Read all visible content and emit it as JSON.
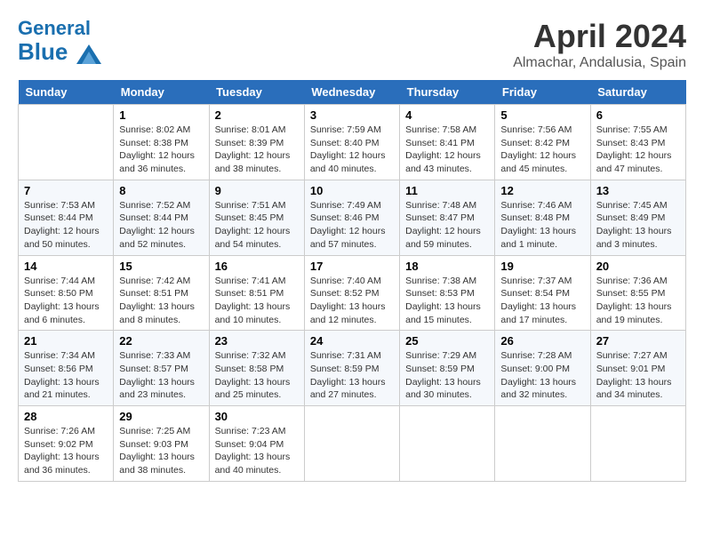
{
  "header": {
    "logo_general": "General",
    "logo_blue": "Blue",
    "month_year": "April 2024",
    "location": "Almachar, Andalusia, Spain"
  },
  "weekdays": [
    "Sunday",
    "Monday",
    "Tuesday",
    "Wednesday",
    "Thursday",
    "Friday",
    "Saturday"
  ],
  "weeks": [
    [
      {
        "day": "",
        "sunrise": "",
        "sunset": "",
        "daylight": ""
      },
      {
        "day": "1",
        "sunrise": "Sunrise: 8:02 AM",
        "sunset": "Sunset: 8:38 PM",
        "daylight": "Daylight: 12 hours and 36 minutes."
      },
      {
        "day": "2",
        "sunrise": "Sunrise: 8:01 AM",
        "sunset": "Sunset: 8:39 PM",
        "daylight": "Daylight: 12 hours and 38 minutes."
      },
      {
        "day": "3",
        "sunrise": "Sunrise: 7:59 AM",
        "sunset": "Sunset: 8:40 PM",
        "daylight": "Daylight: 12 hours and 40 minutes."
      },
      {
        "day": "4",
        "sunrise": "Sunrise: 7:58 AM",
        "sunset": "Sunset: 8:41 PM",
        "daylight": "Daylight: 12 hours and 43 minutes."
      },
      {
        "day": "5",
        "sunrise": "Sunrise: 7:56 AM",
        "sunset": "Sunset: 8:42 PM",
        "daylight": "Daylight: 12 hours and 45 minutes."
      },
      {
        "day": "6",
        "sunrise": "Sunrise: 7:55 AM",
        "sunset": "Sunset: 8:43 PM",
        "daylight": "Daylight: 12 hours and 47 minutes."
      }
    ],
    [
      {
        "day": "7",
        "sunrise": "Sunrise: 7:53 AM",
        "sunset": "Sunset: 8:44 PM",
        "daylight": "Daylight: 12 hours and 50 minutes."
      },
      {
        "day": "8",
        "sunrise": "Sunrise: 7:52 AM",
        "sunset": "Sunset: 8:44 PM",
        "daylight": "Daylight: 12 hours and 52 minutes."
      },
      {
        "day": "9",
        "sunrise": "Sunrise: 7:51 AM",
        "sunset": "Sunset: 8:45 PM",
        "daylight": "Daylight: 12 hours and 54 minutes."
      },
      {
        "day": "10",
        "sunrise": "Sunrise: 7:49 AM",
        "sunset": "Sunset: 8:46 PM",
        "daylight": "Daylight: 12 hours and 57 minutes."
      },
      {
        "day": "11",
        "sunrise": "Sunrise: 7:48 AM",
        "sunset": "Sunset: 8:47 PM",
        "daylight": "Daylight: 12 hours and 59 minutes."
      },
      {
        "day": "12",
        "sunrise": "Sunrise: 7:46 AM",
        "sunset": "Sunset: 8:48 PM",
        "daylight": "Daylight: 13 hours and 1 minute."
      },
      {
        "day": "13",
        "sunrise": "Sunrise: 7:45 AM",
        "sunset": "Sunset: 8:49 PM",
        "daylight": "Daylight: 13 hours and 3 minutes."
      }
    ],
    [
      {
        "day": "14",
        "sunrise": "Sunrise: 7:44 AM",
        "sunset": "Sunset: 8:50 PM",
        "daylight": "Daylight: 13 hours and 6 minutes."
      },
      {
        "day": "15",
        "sunrise": "Sunrise: 7:42 AM",
        "sunset": "Sunset: 8:51 PM",
        "daylight": "Daylight: 13 hours and 8 minutes."
      },
      {
        "day": "16",
        "sunrise": "Sunrise: 7:41 AM",
        "sunset": "Sunset: 8:51 PM",
        "daylight": "Daylight: 13 hours and 10 minutes."
      },
      {
        "day": "17",
        "sunrise": "Sunrise: 7:40 AM",
        "sunset": "Sunset: 8:52 PM",
        "daylight": "Daylight: 13 hours and 12 minutes."
      },
      {
        "day": "18",
        "sunrise": "Sunrise: 7:38 AM",
        "sunset": "Sunset: 8:53 PM",
        "daylight": "Daylight: 13 hours and 15 minutes."
      },
      {
        "day": "19",
        "sunrise": "Sunrise: 7:37 AM",
        "sunset": "Sunset: 8:54 PM",
        "daylight": "Daylight: 13 hours and 17 minutes."
      },
      {
        "day": "20",
        "sunrise": "Sunrise: 7:36 AM",
        "sunset": "Sunset: 8:55 PM",
        "daylight": "Daylight: 13 hours and 19 minutes."
      }
    ],
    [
      {
        "day": "21",
        "sunrise": "Sunrise: 7:34 AM",
        "sunset": "Sunset: 8:56 PM",
        "daylight": "Daylight: 13 hours and 21 minutes."
      },
      {
        "day": "22",
        "sunrise": "Sunrise: 7:33 AM",
        "sunset": "Sunset: 8:57 PM",
        "daylight": "Daylight: 13 hours and 23 minutes."
      },
      {
        "day": "23",
        "sunrise": "Sunrise: 7:32 AM",
        "sunset": "Sunset: 8:58 PM",
        "daylight": "Daylight: 13 hours and 25 minutes."
      },
      {
        "day": "24",
        "sunrise": "Sunrise: 7:31 AM",
        "sunset": "Sunset: 8:59 PM",
        "daylight": "Daylight: 13 hours and 27 minutes."
      },
      {
        "day": "25",
        "sunrise": "Sunrise: 7:29 AM",
        "sunset": "Sunset: 8:59 PM",
        "daylight": "Daylight: 13 hours and 30 minutes."
      },
      {
        "day": "26",
        "sunrise": "Sunrise: 7:28 AM",
        "sunset": "Sunset: 9:00 PM",
        "daylight": "Daylight: 13 hours and 32 minutes."
      },
      {
        "day": "27",
        "sunrise": "Sunrise: 7:27 AM",
        "sunset": "Sunset: 9:01 PM",
        "daylight": "Daylight: 13 hours and 34 minutes."
      }
    ],
    [
      {
        "day": "28",
        "sunrise": "Sunrise: 7:26 AM",
        "sunset": "Sunset: 9:02 PM",
        "daylight": "Daylight: 13 hours and 36 minutes."
      },
      {
        "day": "29",
        "sunrise": "Sunrise: 7:25 AM",
        "sunset": "Sunset: 9:03 PM",
        "daylight": "Daylight: 13 hours and 38 minutes."
      },
      {
        "day": "30",
        "sunrise": "Sunrise: 7:23 AM",
        "sunset": "Sunset: 9:04 PM",
        "daylight": "Daylight: 13 hours and 40 minutes."
      },
      {
        "day": "",
        "sunrise": "",
        "sunset": "",
        "daylight": ""
      },
      {
        "day": "",
        "sunrise": "",
        "sunset": "",
        "daylight": ""
      },
      {
        "day": "",
        "sunrise": "",
        "sunset": "",
        "daylight": ""
      },
      {
        "day": "",
        "sunrise": "",
        "sunset": "",
        "daylight": ""
      }
    ]
  ]
}
